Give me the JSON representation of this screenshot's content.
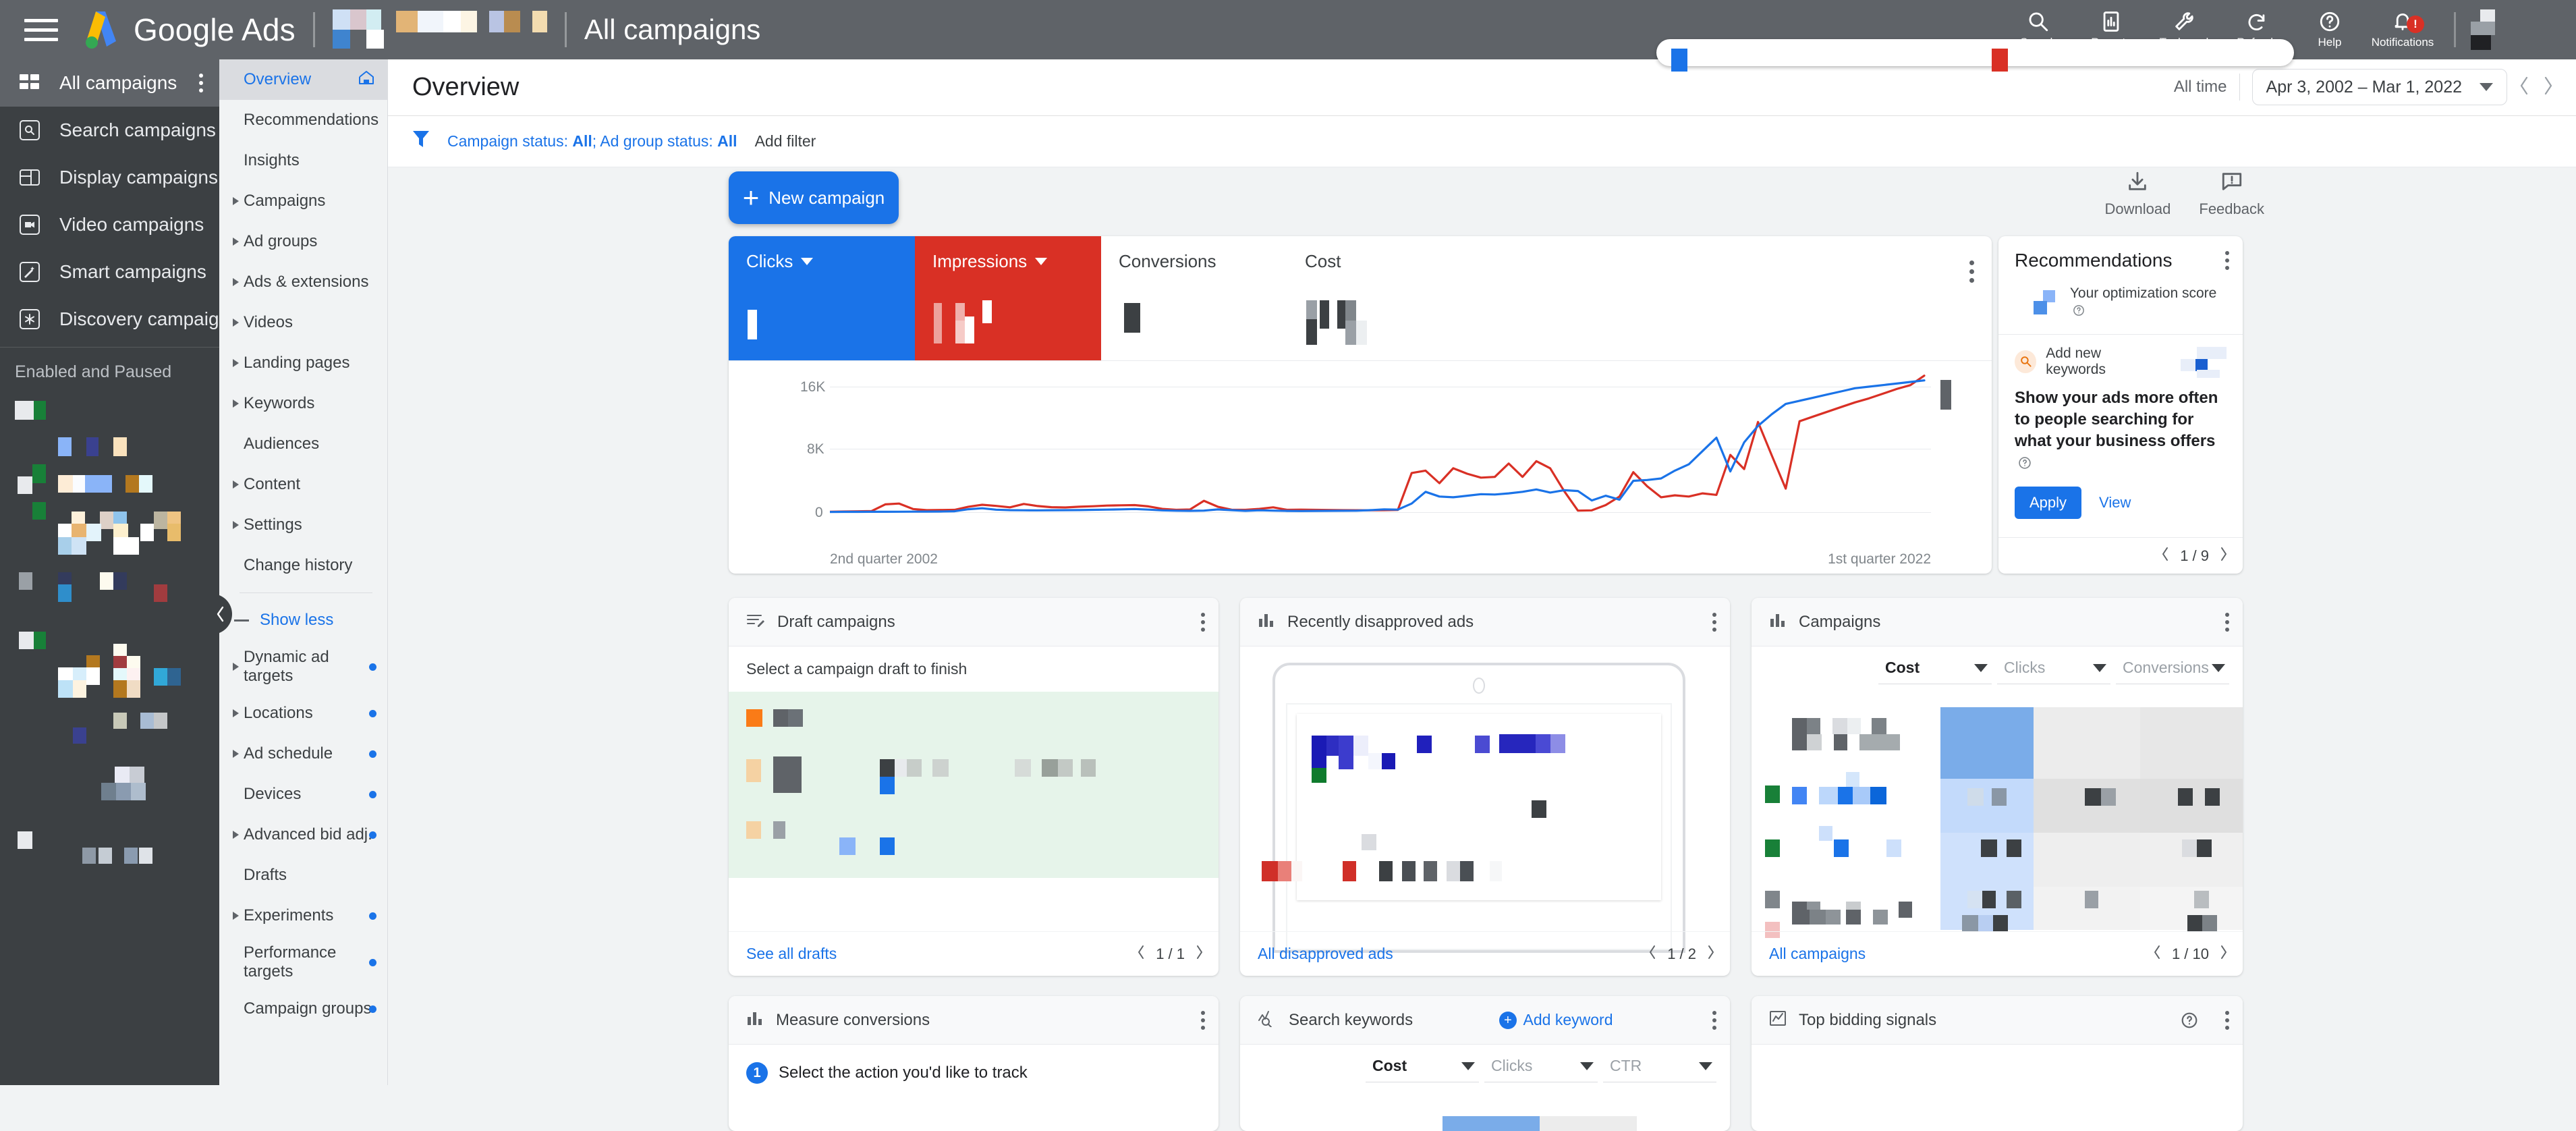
{
  "topbar": {
    "product_name": "Google Ads",
    "page_label": "All campaigns",
    "items": [
      {
        "label": "Search",
        "icon": "search-icon"
      },
      {
        "label": "Reports",
        "icon": "reports-icon"
      },
      {
        "label": "Tools and",
        "icon": "tools-icon"
      },
      {
        "label": "Refresh",
        "icon": "refresh-icon"
      },
      {
        "label": "Help",
        "icon": "help-icon"
      },
      {
        "label": "Notifications",
        "icon": "bell-icon",
        "badge": "!"
      }
    ]
  },
  "leftnav": {
    "header": {
      "label": "All campaigns",
      "icon": "grid-icon"
    },
    "items": [
      {
        "label": "Search campaigns",
        "icon": "search-campaigns-icon"
      },
      {
        "label": "Display campaigns",
        "icon": "display-campaigns-icon"
      },
      {
        "label": "Video campaigns",
        "icon": "video-campaigns-icon"
      },
      {
        "label": "Smart campaigns",
        "icon": "smart-campaigns-icon"
      },
      {
        "label": "Discovery campaigns",
        "icon": "discovery-campaigns-icon"
      }
    ],
    "section_label": "Enabled and Paused"
  },
  "secnav": {
    "items": [
      {
        "label": "Overview",
        "active": true,
        "expandable": false,
        "icon": "home-icon"
      },
      {
        "label": "Recommendations",
        "active": false,
        "expandable": false
      },
      {
        "label": "Insights",
        "active": false,
        "expandable": false
      },
      {
        "label": "Campaigns",
        "active": false,
        "expandable": true
      },
      {
        "label": "Ad groups",
        "active": false,
        "expandable": true
      },
      {
        "label": "Ads & extensions",
        "active": false,
        "expandable": true
      },
      {
        "label": "Videos",
        "active": false,
        "expandable": true
      },
      {
        "label": "Landing pages",
        "active": false,
        "expandable": true
      },
      {
        "label": "Keywords",
        "active": false,
        "expandable": true
      },
      {
        "label": "Audiences",
        "active": false,
        "expandable": false
      },
      {
        "label": "Content",
        "active": false,
        "expandable": true
      },
      {
        "label": "Settings",
        "active": false,
        "expandable": true
      },
      {
        "label": "Change history",
        "active": false,
        "expandable": false
      }
    ],
    "show_less": "Show less",
    "items2": [
      {
        "label": "Dynamic ad targets",
        "expandable": true,
        "dot": true,
        "two_line": true
      },
      {
        "label": "Locations",
        "expandable": true,
        "dot": true
      },
      {
        "label": "Ad schedule",
        "expandable": true,
        "dot": true
      },
      {
        "label": "Devices",
        "expandable": false,
        "dot": true
      },
      {
        "label": "Advanced bid adj.",
        "expandable": true,
        "dot": true
      },
      {
        "label": "Drafts",
        "expandable": false,
        "dot": false
      },
      {
        "label": "Experiments",
        "expandable": true,
        "dot": true
      },
      {
        "label": "Performance targets",
        "expandable": false,
        "dot": true,
        "two_line": true
      },
      {
        "label": "Campaign groups",
        "expandable": false,
        "dot": true
      }
    ]
  },
  "page": {
    "title": "Overview",
    "filter": {
      "chip_prefix": "Campaign status: ",
      "chip_value_1": "All",
      "chip_middle": "; Ad group status: ",
      "chip_value_2": "All",
      "add_filter": "Add filter"
    },
    "date": {
      "preset": "All time",
      "range": "Apr 3, 2002 – Mar 1, 2022"
    },
    "new_campaign": "New campaign",
    "download": "Download",
    "feedback": "Feedback"
  },
  "kpi": {
    "tiles": [
      {
        "name": "Clicks",
        "selected": "blue",
        "has_dropdown": true
      },
      {
        "name": "Impressions",
        "selected": "red",
        "has_dropdown": true
      },
      {
        "name": "Conversions",
        "selected": "none",
        "has_dropdown": false
      },
      {
        "name": "Cost",
        "selected": "none",
        "has_dropdown": false
      }
    ]
  },
  "chart_data": {
    "type": "line",
    "title": "",
    "xlabel": "",
    "ylabel": "",
    "ylim": [
      0,
      17600
    ],
    "yticks": [
      0,
      8000,
      16000
    ],
    "ytick_labels": [
      "0",
      "8K",
      "16K"
    ],
    "grid": true,
    "legend_position": "none",
    "x_axis_start_label": "2nd quarter 2002",
    "x_axis_end_label": "1st quarter 2022",
    "x": [
      "2002 Q2",
      "2002 Q3",
      "2002 Q4",
      "2003 Q1",
      "2003 Q2",
      "2003 Q3",
      "2003 Q4",
      "2004 Q1",
      "2004 Q2",
      "2004 Q3",
      "2004 Q4",
      "2005 Q1",
      "2005 Q2",
      "2005 Q3",
      "2005 Q4",
      "2006 Q1",
      "2006 Q2",
      "2006 Q3",
      "2006 Q4",
      "2007 Q1",
      "2007 Q2",
      "2007 Q3",
      "2007 Q4",
      "2008 Q1",
      "2008 Q2",
      "2008 Q3",
      "2008 Q4",
      "2009 Q1",
      "2009 Q2",
      "2009 Q3",
      "2009 Q4",
      "2010 Q1",
      "2010 Q2",
      "2010 Q3",
      "2010 Q4",
      "2011 Q1",
      "2011 Q2",
      "2011 Q3",
      "2011 Q4",
      "2012 Q1",
      "2012 Q2",
      "2012 Q3",
      "2012 Q4",
      "2013 Q1",
      "2013 Q2",
      "2013 Q3",
      "2013 Q4",
      "2014 Q1",
      "2014 Q2",
      "2014 Q3",
      "2014 Q4",
      "2015 Q1",
      "2015 Q2",
      "2015 Q3",
      "2015 Q4",
      "2016 Q1",
      "2016 Q2",
      "2016 Q3",
      "2016 Q4",
      "2017 Q1",
      "2017 Q2",
      "2017 Q3",
      "2017 Q4",
      "2018 Q1",
      "2018 Q2",
      "2018 Q3",
      "2018 Q4",
      "2019 Q1",
      "2019 Q2",
      "2019 Q3",
      "2019 Q4",
      "2020 Q1",
      "2020 Q2",
      "2020 Q3",
      "2020 Q4",
      "2021 Q1",
      "2021 Q2",
      "2021 Q3",
      "2021 Q4",
      "2022 Q1"
    ],
    "series": [
      {
        "name": "Clicks",
        "color": "#1a73e8",
        "values": [
          30,
          40,
          45,
          50,
          55,
          60,
          70,
          80,
          90,
          120,
          380,
          500,
          320,
          260,
          240,
          230,
          250,
          260,
          270,
          300,
          330,
          360,
          400,
          330,
          230,
          190,
          170,
          200,
          350,
          260,
          170,
          240,
          200,
          160,
          150,
          160,
          170,
          180,
          190,
          260,
          360,
          330,
          1100,
          2600,
          2000,
          1900,
          2100,
          2300,
          2250,
          2400,
          2600,
          2900,
          2500,
          2800,
          2700,
          1500,
          2100,
          1600,
          4000,
          4100,
          4300,
          5300,
          6100,
          7800,
          9500,
          5200,
          8900,
          11000,
          12500,
          13800,
          14200,
          14600,
          15000,
          15400,
          15800,
          16000,
          16200,
          16400,
          16600,
          16800
        ]
      },
      {
        "name": "Impressions",
        "color": "#d93025",
        "values": [
          60,
          90,
          110,
          140,
          1000,
          1100,
          400,
          260,
          280,
          300,
          700,
          950,
          800,
          620,
          1050,
          780,
          640,
          600,
          700,
          760,
          840,
          880,
          900,
          740,
          420,
          300,
          340,
          1450,
          700,
          320,
          300,
          420,
          620,
          300,
          330,
          300,
          280,
          260,
          250,
          240,
          260,
          280,
          5000,
          5300,
          3700,
          5600,
          4900,
          4400,
          4500,
          6200,
          4500,
          6500,
          5600,
          2700,
          200,
          230,
          900,
          2000,
          5100,
          3300,
          1900,
          2150,
          2000,
          2400,
          2200,
          7300,
          5500,
          11500,
          7200,
          3000,
          11600,
          12200,
          12800,
          13400,
          14000,
          14500,
          15100,
          15700,
          16200,
          17400
        ]
      }
    ]
  },
  "recommendations": {
    "title": "Recommendations",
    "score_label": "Your optimization score",
    "keyword_chip": "Add new keywords",
    "headline": "Show your ads more often to people searching for what your business offers",
    "apply": "Apply",
    "view": "View",
    "page": "1 / 9"
  },
  "cards": {
    "draft_campaigns": {
      "title": "Draft campaigns",
      "icon": "draft-icon",
      "subtext": "Select a campaign draft to finish",
      "link": "See all drafts",
      "page": "1 / 1"
    },
    "disapproved_ads": {
      "title": "Recently disapproved ads",
      "icon": "bar-chart-icon",
      "link": "All disapproved ads",
      "page": "1 / 2"
    },
    "campaigns": {
      "title": "Campaigns",
      "icon": "bar-chart-icon",
      "metrics": [
        {
          "label": "Cost",
          "selected": true
        },
        {
          "label": "Clicks",
          "selected": false
        },
        {
          "label": "Conversions",
          "selected": false
        }
      ],
      "link": "All campaigns",
      "page": "1 / 10"
    },
    "measure_conversions": {
      "title": "Measure conversions",
      "icon": "bar-chart-icon",
      "step_number": "1",
      "step_text": "Select the action you'd like to track"
    },
    "search_keywords": {
      "title": "Search keywords",
      "icon": "search-keywords-icon",
      "add_keyword": "Add keyword",
      "metrics": [
        {
          "label": "Cost",
          "selected": true
        },
        {
          "label": "Clicks",
          "selected": false
        },
        {
          "label": "CTR",
          "selected": false
        }
      ]
    },
    "top_bidding_signals": {
      "title": "Top bidding signals",
      "icon": "trend-icon"
    }
  },
  "colors": {
    "accent_blue": "#1a73e8",
    "accent_red": "#d93025",
    "topbar_gray": "#5f6368",
    "nav_gray": "#3c4043",
    "page_bg": "#f1f3f4"
  }
}
